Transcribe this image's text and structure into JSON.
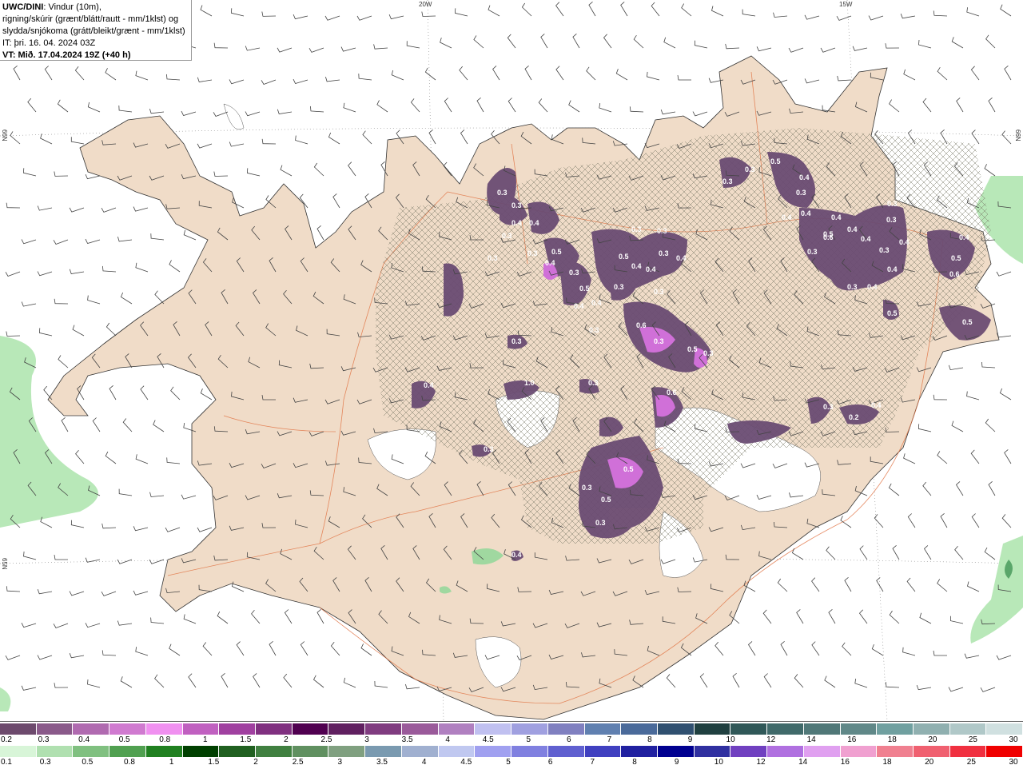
{
  "title": {
    "source": "UWC/DINI",
    "line1": ": Vindur (10m),",
    "line2": "rigning/skúrir (grænt/blátt/rautt - mm/1klst) og",
    "line3": "slydda/snjókoma (grátt/bleikt/grænt - mm/1klst)",
    "issue_time": "IT: þri. 16. 04. 2024 03Z",
    "valid_time": "VT: Mið. 17.04.2024 19Z (+40 h)"
  },
  "graticule": {
    "lon_20w": "20W",
    "lon_15w": "15W",
    "lat_66n_left": "66N",
    "lat_66n_right": "66N",
    "lat_65n_left": "65N"
  },
  "precip_labels": [
    "0.3",
    "0.3",
    "0.4",
    "0.4",
    "0.3",
    "0.3",
    "0.5",
    "0.4",
    "0.3",
    "0.4",
    "0.5",
    "0.4",
    "0.3",
    "0.3",
    "0.3",
    "0.3",
    "0.3",
    "0.4",
    "0.3",
    "0.5",
    "0.4",
    "0.3",
    "0.4",
    "0.3",
    "0.3",
    "0.3",
    "0.5",
    "0.4",
    "0.3",
    "0.4",
    "0.4",
    "0.4",
    "0.6",
    "0.4",
    "0.4",
    "0.3",
    "0.3",
    "0.3",
    "0.3",
    "0.3",
    "0.5",
    "0.4",
    "0.4",
    "0.4",
    "0.5",
    "0.4",
    "0.5",
    "0.6",
    "0.5",
    "0.5",
    "0.3",
    "0.3",
    "0.2",
    "0.4",
    "0.6",
    "0.3",
    "0.3",
    "0.4",
    "1.0",
    "0.5",
    "0.5",
    "0.3",
    "0.3",
    "0.4",
    "0.3",
    "0.6"
  ],
  "snow_scale": {
    "colors": [
      "#6d4a6d",
      "#8a5a8a",
      "#b06ab0",
      "#d07ad0",
      "#f090f0",
      "#c060c0",
      "#a040a0",
      "#803080",
      "#500050",
      "#602060",
      "#803c80",
      "#9a5a9a",
      "#b080c0",
      "#c0c0f0",
      "#a0a0e0",
      "#8080c0",
      "#6080b0",
      "#4a6a9a",
      "#305070",
      "#204040",
      "#305858",
      "#406a6a",
      "#507878",
      "#608888",
      "#70a0a0",
      "#90b0b0",
      "#b0c8c8",
      "#d0e0e0"
    ],
    "labels": [
      "0.2",
      "0.3",
      "0.4",
      "0.5",
      "0.8",
      "1",
      "1.5",
      "2",
      "2.5",
      "3",
      "3.5",
      "4",
      "4.5",
      "5",
      "6",
      "7",
      "8",
      "9",
      "10",
      "12",
      "14",
      "16",
      "18",
      "20",
      "25",
      "30"
    ]
  },
  "rain_scale": {
    "colors": [
      "#d8f5d8",
      "#b0e0b0",
      "#80c080",
      "#50a050",
      "#208020",
      "#004000",
      "#206020",
      "#408040",
      "#609060",
      "#80a080",
      "#7a9ab0",
      "#a0b0d0",
      "#c0c8f0",
      "#a0a0f0",
      "#8080e0",
      "#6060d0",
      "#4040c0",
      "#2020a0",
      "#000090",
      "#3030a0",
      "#7040c0",
      "#b070e0",
      "#e0a0f0",
      "#f0a0d0",
      "#f08090",
      "#f06070",
      "#f03040",
      "#f00000"
    ],
    "labels": [
      "0.1",
      "0.3",
      "0.5",
      "0.8",
      "1",
      "1.5",
      "2",
      "2.5",
      "3",
      "3.5",
      "4",
      "4.5",
      "5",
      "6",
      "7",
      "8",
      "9",
      "10",
      "12",
      "14",
      "16",
      "18",
      "20",
      "25",
      "30"
    ]
  }
}
